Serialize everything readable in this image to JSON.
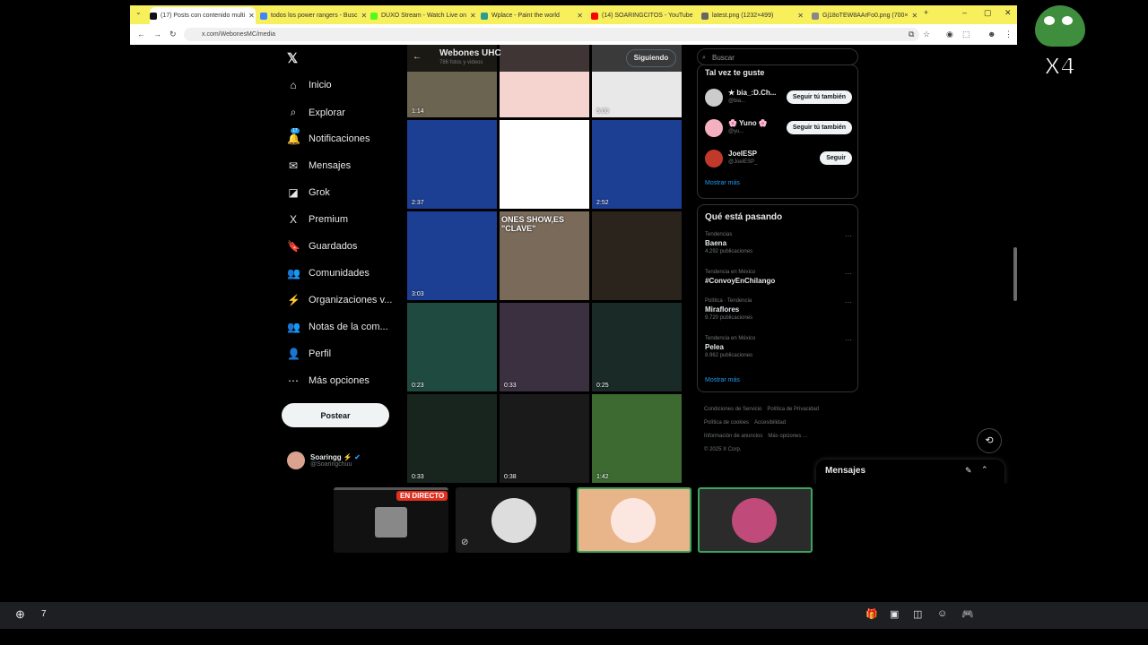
{
  "browser": {
    "tabs": [
      {
        "label": "(17) Posts con contenido multi",
        "fav": "#111",
        "active": true
      },
      {
        "label": "todos los power rangers - Busc",
        "fav": "#4285f4"
      },
      {
        "label": "DUXO Stream - Watch Live on",
        "fav": "#53fc18"
      },
      {
        "label": "Wplace - Paint the world",
        "fav": "#2a9d8f"
      },
      {
        "label": "(14) SOARINGCITOS - YouTube",
        "fav": "#ff0000"
      },
      {
        "label": "latest.png (1232×499)",
        "fav": "#666"
      },
      {
        "label": "Gj18oTEW8AArFo0.png (700×",
        "fav": "#888"
      }
    ],
    "url": "x.com/WebonesMC/media"
  },
  "sidebar": {
    "items": [
      {
        "label": "Inicio",
        "icon": "⌂",
        "name": "home-icon"
      },
      {
        "label": "Explorar",
        "icon": "⌕",
        "name": "search-icon"
      },
      {
        "label": "Notificaciones",
        "icon": "🔔",
        "name": "bell-icon",
        "badge": "17"
      },
      {
        "label": "Mensajes",
        "icon": "✉",
        "name": "mail-icon"
      },
      {
        "label": "Grok",
        "icon": "◪",
        "name": "grok-icon"
      },
      {
        "label": "Premium",
        "icon": "X",
        "name": "x-premium-icon"
      },
      {
        "label": "Guardados",
        "icon": "🔖",
        "name": "bookmark-icon"
      },
      {
        "label": "Comunidades",
        "icon": "👥",
        "name": "communities-icon"
      },
      {
        "label": "Organizaciones v...",
        "icon": "⚡",
        "name": "lightning-icon"
      },
      {
        "label": "Notas de la com...",
        "icon": "👥",
        "name": "notes-icon"
      },
      {
        "label": "Perfil",
        "icon": "👤",
        "name": "person-icon"
      },
      {
        "label": "Más opciones",
        "icon": "⋯",
        "name": "more-icon"
      }
    ],
    "post_label": "Postear",
    "profile_name": "Soaringg ⚡",
    "profile_handle": "@Soaringchuu"
  },
  "center": {
    "title": "Webones UHC",
    "subtitle": "786 fotos y videos",
    "follow_label": "Siguiendo",
    "tiles": [
      {
        "dur": "1:14",
        "bg": "#6b6450"
      },
      {
        "dur": "",
        "bg": "#f5d4d0"
      },
      {
        "dur": "5:00",
        "bg": "#e8e8e8"
      },
      {
        "dur": "2:37",
        "bg": "#1c3f94"
      },
      {
        "dur": "",
        "bg": "#ffffff"
      },
      {
        "dur": "2:52",
        "bg": "#1c3f94"
      },
      {
        "dur": "3:03",
        "bg": "#1c3f94"
      },
      {
        "dur": "",
        "bg": "#7a6a5a",
        "text": "ONES SHOW,ES \"CLAVE\""
      },
      {
        "dur": "",
        "bg": "#2b241c"
      },
      {
        "dur": "0:23",
        "bg": "#1f4a40"
      },
      {
        "dur": "0:33",
        "bg": "#3a3040"
      },
      {
        "dur": "0:25",
        "bg": "#1a2a26"
      },
      {
        "dur": "0:33",
        "bg": "#18251f"
      },
      {
        "dur": "0:38",
        "bg": "#1a1a1a"
      },
      {
        "dur": "1:42",
        "bg": "#3c6a30"
      }
    ]
  },
  "right": {
    "search_placeholder": "Buscar",
    "suggest_title": "Tal vez te guste",
    "suggestions": [
      {
        "name": "★ bia_:D.Ch...",
        "handle": "@bia...",
        "btn": "Seguir tú también",
        "color": "#cccccc"
      },
      {
        "name": "🌸 Yuno 🌸",
        "handle": "@yu...",
        "btn": "Seguir tú también",
        "color": "#f4b0c0"
      },
      {
        "name": "JoelESP",
        "handle": "@JoelESP_",
        "btn": "Seguir",
        "color": "#c0392b"
      }
    ],
    "show_more": "Mostrar más",
    "trends_title": "Qué está pasando",
    "trends": [
      {
        "context": "Tendencias",
        "topic": "Baena",
        "posts": "4.292 publicaciones"
      },
      {
        "context": "Tendencia en México",
        "topic": "#ConvoyEnChilango",
        "posts": ""
      },
      {
        "context": "Política · Tendencia",
        "topic": "Miraflores",
        "posts": "9.720 publicaciones"
      },
      {
        "context": "Tendencia en México",
        "topic": "Pelea",
        "posts": "8.962 publicaciones"
      }
    ],
    "footer": [
      "Condiciones de Servicio",
      "Política de Privacidad",
      "Política de cookies",
      "Accesibilidad",
      "Información de anuncios",
      "Más opciones ...",
      "© 2025 X Corp."
    ],
    "messages_label": "Mensajes"
  },
  "overlay": {
    "live_label": "EN DIRECTO",
    "peepo_label": "X4",
    "taskbar_count": "7"
  }
}
